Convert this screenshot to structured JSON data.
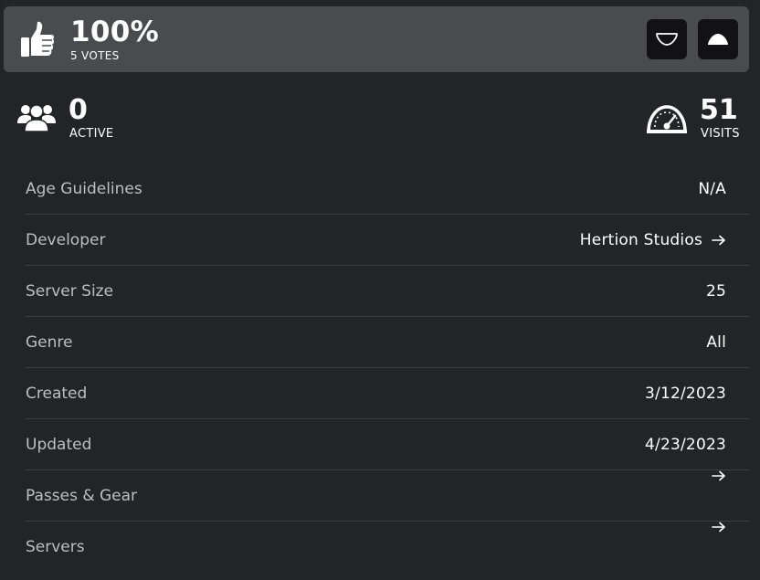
{
  "votes": {
    "percent": "100%",
    "count_label": "5 VOTES",
    "icons": {
      "thumb": "thumbs-up-icon",
      "downvote": "thumbs-down-outline-icon",
      "upvote": "thumbs-up-filled-icon"
    }
  },
  "stats": {
    "active": {
      "value": "0",
      "label": "ACTIVE",
      "icon": "people-icon"
    },
    "visits": {
      "value": "51",
      "label": "VISITS",
      "icon": "speedometer-icon"
    }
  },
  "details": [
    {
      "label": "Age Guidelines",
      "value": "N/A"
    },
    {
      "label": "Developer",
      "value": "Hertion Studios",
      "arrow": true
    },
    {
      "label": "Server Size",
      "value": "25"
    },
    {
      "label": "Genre",
      "value": "All"
    },
    {
      "label": "Created",
      "value": "3/12/2023"
    },
    {
      "label": "Updated",
      "value": "4/23/2023"
    },
    {
      "label": "Passes & Gear",
      "value": "",
      "arrow": true
    },
    {
      "label": "Servers",
      "value": "",
      "arrow": true
    }
  ],
  "colors": {
    "background": "#232427",
    "vote_bar": "#4a4b4f",
    "button": "#121214",
    "label_text": "#bdbec0",
    "divider": "#3e3f43"
  }
}
